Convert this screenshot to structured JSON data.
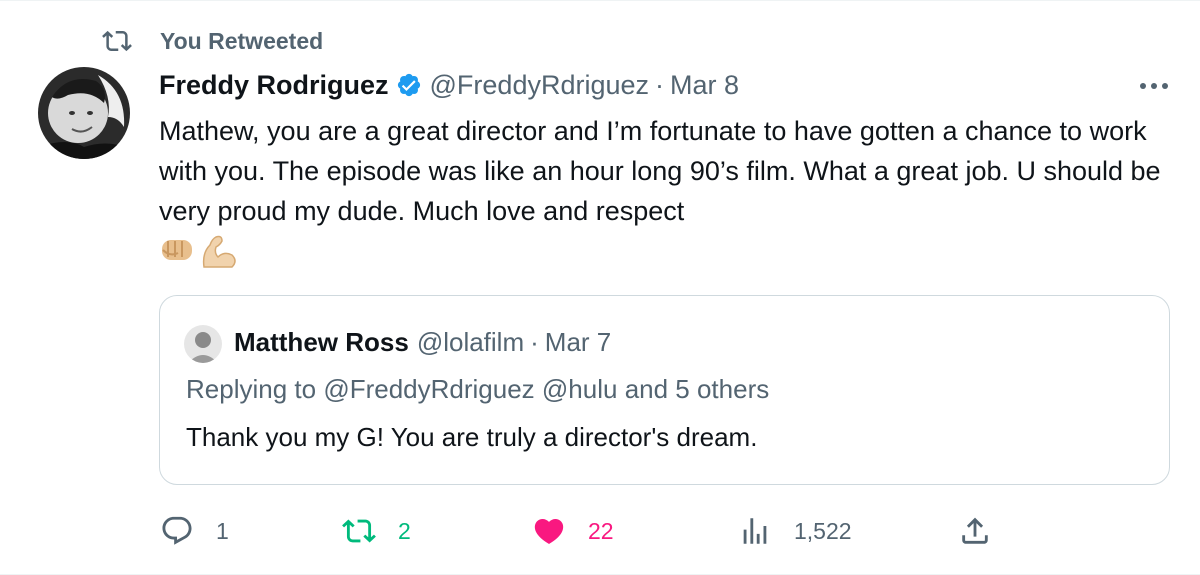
{
  "social_context": {
    "label": "You Retweeted",
    "icon": "retweet-icon"
  },
  "tweet": {
    "author_name": "Freddy Rodriguez",
    "verified": true,
    "handle": "@FreddyRdriguez",
    "separator": "·",
    "date": "Mar 8",
    "text": "Mathew, you are a great director and I’m fortunate to have gotten a chance to work with you. The episode was like an hour long 90’s film. What a great job. U should be very proud my dude. Much love and respect",
    "emojis": [
      "oncoming-fist-emoji",
      "flexed-biceps-emoji"
    ]
  },
  "quote": {
    "author_name": "Matthew Ross",
    "handle": "@lolafilm",
    "separator": "·",
    "date": "Mar 7",
    "replying_prefix": "Replying to",
    "replying_mentions": "@FreddyRdriguez @hulu",
    "replying_suffix": "and 5 others",
    "text": "Thank you my G! You are truly a director's dream."
  },
  "actions": {
    "replies": "1",
    "retweets": "2",
    "likes": "22",
    "views": "1,522"
  },
  "colors": {
    "text_primary": "#0f1419",
    "text_secondary": "#536471",
    "verified_blue": "#1d9bf0",
    "retweet_green": "#00ba7c",
    "like_pink": "#f91880",
    "border": "#cfd9de"
  }
}
